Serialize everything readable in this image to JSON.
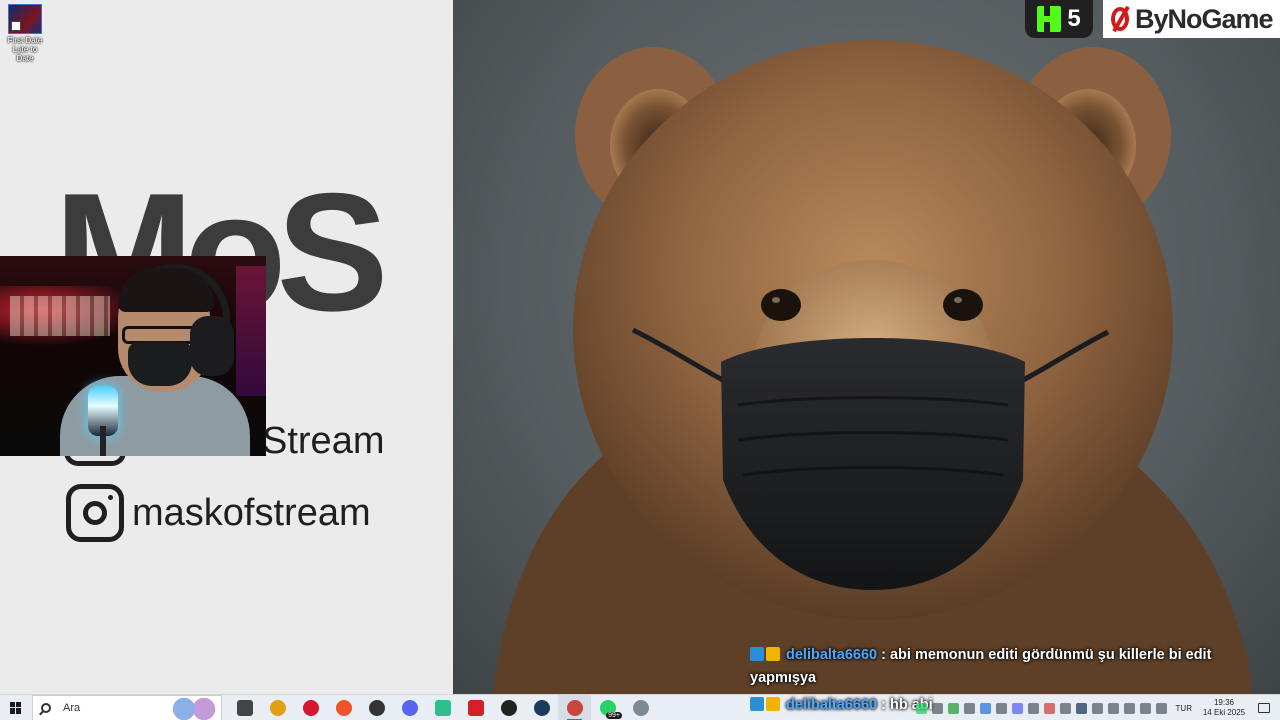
{
  "desktop": {
    "icon_label_line1": "First Date",
    "icon_label_line2": "Late to Date"
  },
  "branding": {
    "logo_text": "MoS",
    "social_partial": "Stream",
    "instagram_handle": "maskofstream"
  },
  "overlay": {
    "kick_count": "5",
    "sponsor_name": "ByNoGame",
    "kick_color": "#53fc18",
    "sponsor_color": "#d21a1a"
  },
  "chat": {
    "messages": [
      {
        "user": "delibalta6660",
        "text": ": abi memonun editi gördünmü şu killerle bi edit yapmışya"
      },
      {
        "user": "delibalta6660",
        "text": ": hb abi"
      }
    ],
    "user_color": "#4aa8ff"
  },
  "taskbar": {
    "search_placeholder": "Ara",
    "apps": [
      {
        "icon": "task-view-icon",
        "color": "#444444"
      },
      {
        "icon": "chrome-icon",
        "color": "#e0a010"
      },
      {
        "icon": "opera-icon",
        "color": "#d4162e"
      },
      {
        "icon": "brave-icon",
        "color": "#f0522a"
      },
      {
        "icon": "audio-app-icon",
        "color": "#333333"
      },
      {
        "icon": "discord-icon",
        "color": "#5865f2"
      },
      {
        "icon": "android-app-icon",
        "color": "#2ec08c"
      },
      {
        "icon": "wps-office-icon",
        "color": "#d3202a"
      },
      {
        "icon": "obs-icon",
        "color": "#222222"
      },
      {
        "icon": "steam-icon",
        "color": "#1b3a5c"
      },
      {
        "icon": "chrome-profile-icon",
        "color": "#c9463d"
      },
      {
        "icon": "whatsapp-icon",
        "color": "#25d366"
      },
      {
        "icon": "shield-app-icon",
        "color": "#7d8a96"
      }
    ],
    "whatsapp_badge": "99+",
    "language": "TUR",
    "time": "19:36",
    "date": "14 Eki 2025"
  }
}
